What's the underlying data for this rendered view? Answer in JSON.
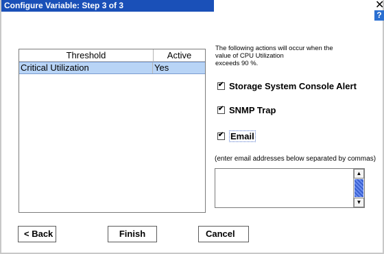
{
  "window": {
    "title": "Configure Variable: Step 3 of 3",
    "close_glyph": "✕",
    "help_glyph": "?"
  },
  "threshold_table": {
    "headers": {
      "threshold": "Threshold",
      "active": "Active"
    },
    "rows": [
      {
        "threshold": "Critical Utilization",
        "active": "Yes"
      }
    ]
  },
  "actions": {
    "intro_line1": "The following actions will occur when the",
    "intro_line2": "value of CPU Utilization",
    "intro_line3": "exceeds 90 %.",
    "options": [
      {
        "label": "Storage System Console Alert",
        "checked": true
      },
      {
        "label": "SNMP Trap",
        "checked": true
      },
      {
        "label": "Email",
        "checked": true
      }
    ]
  },
  "email": {
    "hint": "(enter email addresses below separated by commas)",
    "value": ""
  },
  "buttons": {
    "back": "< Back",
    "finish": "Finish",
    "cancel": "Cancel"
  },
  "colors": {
    "titlebar": "#1a50b8",
    "selection": "#b8d4f6"
  },
  "icons": {
    "close": "close-icon",
    "help": "help-icon",
    "scroll_up": "scroll-up-icon",
    "scroll_down": "scroll-down-icon"
  }
}
